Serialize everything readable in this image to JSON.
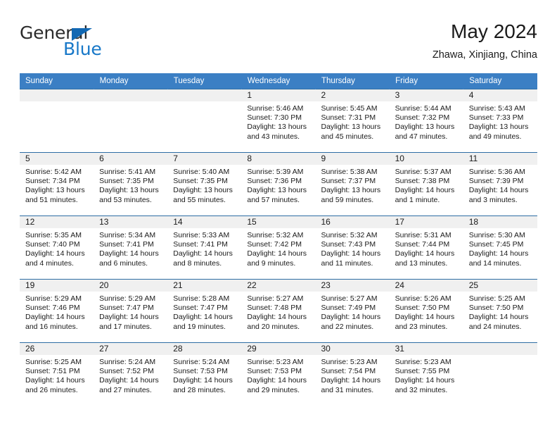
{
  "brand": {
    "name_top": "General",
    "name_bottom": "Blue",
    "triangle_color": "#1268b3",
    "blue_text_color": "#1878c8"
  },
  "header": {
    "title": "May 2024",
    "location": "Zhawa, Xinjiang, China"
  },
  "theme": {
    "header_blue": "#3b7fc4",
    "row_rule_blue": "#2e6da4",
    "daynum_band": "#f0f0f0",
    "text": "#1a1a1a"
  },
  "calendar": {
    "weekday_headers": [
      "Sunday",
      "Monday",
      "Tuesday",
      "Wednesday",
      "Thursday",
      "Friday",
      "Saturday"
    ],
    "weeks": [
      [
        {
          "day": "",
          "sunrise": "",
          "sunset": "",
          "daylight_line1": "",
          "daylight_line2": ""
        },
        {
          "day": "",
          "sunrise": "",
          "sunset": "",
          "daylight_line1": "",
          "daylight_line2": ""
        },
        {
          "day": "",
          "sunrise": "",
          "sunset": "",
          "daylight_line1": "",
          "daylight_line2": ""
        },
        {
          "day": "1",
          "sunrise": "Sunrise: 5:46 AM",
          "sunset": "Sunset: 7:30 PM",
          "daylight_line1": "Daylight: 13 hours",
          "daylight_line2": "and 43 minutes."
        },
        {
          "day": "2",
          "sunrise": "Sunrise: 5:45 AM",
          "sunset": "Sunset: 7:31 PM",
          "daylight_line1": "Daylight: 13 hours",
          "daylight_line2": "and 45 minutes."
        },
        {
          "day": "3",
          "sunrise": "Sunrise: 5:44 AM",
          "sunset": "Sunset: 7:32 PM",
          "daylight_line1": "Daylight: 13 hours",
          "daylight_line2": "and 47 minutes."
        },
        {
          "day": "4",
          "sunrise": "Sunrise: 5:43 AM",
          "sunset": "Sunset: 7:33 PM",
          "daylight_line1": "Daylight: 13 hours",
          "daylight_line2": "and 49 minutes."
        }
      ],
      [
        {
          "day": "5",
          "sunrise": "Sunrise: 5:42 AM",
          "sunset": "Sunset: 7:34 PM",
          "daylight_line1": "Daylight: 13 hours",
          "daylight_line2": "and 51 minutes."
        },
        {
          "day": "6",
          "sunrise": "Sunrise: 5:41 AM",
          "sunset": "Sunset: 7:35 PM",
          "daylight_line1": "Daylight: 13 hours",
          "daylight_line2": "and 53 minutes."
        },
        {
          "day": "7",
          "sunrise": "Sunrise: 5:40 AM",
          "sunset": "Sunset: 7:35 PM",
          "daylight_line1": "Daylight: 13 hours",
          "daylight_line2": "and 55 minutes."
        },
        {
          "day": "8",
          "sunrise": "Sunrise: 5:39 AM",
          "sunset": "Sunset: 7:36 PM",
          "daylight_line1": "Daylight: 13 hours",
          "daylight_line2": "and 57 minutes."
        },
        {
          "day": "9",
          "sunrise": "Sunrise: 5:38 AM",
          "sunset": "Sunset: 7:37 PM",
          "daylight_line1": "Daylight: 13 hours",
          "daylight_line2": "and 59 minutes."
        },
        {
          "day": "10",
          "sunrise": "Sunrise: 5:37 AM",
          "sunset": "Sunset: 7:38 PM",
          "daylight_line1": "Daylight: 14 hours",
          "daylight_line2": "and 1 minute."
        },
        {
          "day": "11",
          "sunrise": "Sunrise: 5:36 AM",
          "sunset": "Sunset: 7:39 PM",
          "daylight_line1": "Daylight: 14 hours",
          "daylight_line2": "and 3 minutes."
        }
      ],
      [
        {
          "day": "12",
          "sunrise": "Sunrise: 5:35 AM",
          "sunset": "Sunset: 7:40 PM",
          "daylight_line1": "Daylight: 14 hours",
          "daylight_line2": "and 4 minutes."
        },
        {
          "day": "13",
          "sunrise": "Sunrise: 5:34 AM",
          "sunset": "Sunset: 7:41 PM",
          "daylight_line1": "Daylight: 14 hours",
          "daylight_line2": "and 6 minutes."
        },
        {
          "day": "14",
          "sunrise": "Sunrise: 5:33 AM",
          "sunset": "Sunset: 7:41 PM",
          "daylight_line1": "Daylight: 14 hours",
          "daylight_line2": "and 8 minutes."
        },
        {
          "day": "15",
          "sunrise": "Sunrise: 5:32 AM",
          "sunset": "Sunset: 7:42 PM",
          "daylight_line1": "Daylight: 14 hours",
          "daylight_line2": "and 9 minutes."
        },
        {
          "day": "16",
          "sunrise": "Sunrise: 5:32 AM",
          "sunset": "Sunset: 7:43 PM",
          "daylight_line1": "Daylight: 14 hours",
          "daylight_line2": "and 11 minutes."
        },
        {
          "day": "17",
          "sunrise": "Sunrise: 5:31 AM",
          "sunset": "Sunset: 7:44 PM",
          "daylight_line1": "Daylight: 14 hours",
          "daylight_line2": "and 13 minutes."
        },
        {
          "day": "18",
          "sunrise": "Sunrise: 5:30 AM",
          "sunset": "Sunset: 7:45 PM",
          "daylight_line1": "Daylight: 14 hours",
          "daylight_line2": "and 14 minutes."
        }
      ],
      [
        {
          "day": "19",
          "sunrise": "Sunrise: 5:29 AM",
          "sunset": "Sunset: 7:46 PM",
          "daylight_line1": "Daylight: 14 hours",
          "daylight_line2": "and 16 minutes."
        },
        {
          "day": "20",
          "sunrise": "Sunrise: 5:29 AM",
          "sunset": "Sunset: 7:47 PM",
          "daylight_line1": "Daylight: 14 hours",
          "daylight_line2": "and 17 minutes."
        },
        {
          "day": "21",
          "sunrise": "Sunrise: 5:28 AM",
          "sunset": "Sunset: 7:47 PM",
          "daylight_line1": "Daylight: 14 hours",
          "daylight_line2": "and 19 minutes."
        },
        {
          "day": "22",
          "sunrise": "Sunrise: 5:27 AM",
          "sunset": "Sunset: 7:48 PM",
          "daylight_line1": "Daylight: 14 hours",
          "daylight_line2": "and 20 minutes."
        },
        {
          "day": "23",
          "sunrise": "Sunrise: 5:27 AM",
          "sunset": "Sunset: 7:49 PM",
          "daylight_line1": "Daylight: 14 hours",
          "daylight_line2": "and 22 minutes."
        },
        {
          "day": "24",
          "sunrise": "Sunrise: 5:26 AM",
          "sunset": "Sunset: 7:50 PM",
          "daylight_line1": "Daylight: 14 hours",
          "daylight_line2": "and 23 minutes."
        },
        {
          "day": "25",
          "sunrise": "Sunrise: 5:25 AM",
          "sunset": "Sunset: 7:50 PM",
          "daylight_line1": "Daylight: 14 hours",
          "daylight_line2": "and 24 minutes."
        }
      ],
      [
        {
          "day": "26",
          "sunrise": "Sunrise: 5:25 AM",
          "sunset": "Sunset: 7:51 PM",
          "daylight_line1": "Daylight: 14 hours",
          "daylight_line2": "and 26 minutes."
        },
        {
          "day": "27",
          "sunrise": "Sunrise: 5:24 AM",
          "sunset": "Sunset: 7:52 PM",
          "daylight_line1": "Daylight: 14 hours",
          "daylight_line2": "and 27 minutes."
        },
        {
          "day": "28",
          "sunrise": "Sunrise: 5:24 AM",
          "sunset": "Sunset: 7:53 PM",
          "daylight_line1": "Daylight: 14 hours",
          "daylight_line2": "and 28 minutes."
        },
        {
          "day": "29",
          "sunrise": "Sunrise: 5:23 AM",
          "sunset": "Sunset: 7:53 PM",
          "daylight_line1": "Daylight: 14 hours",
          "daylight_line2": "and 29 minutes."
        },
        {
          "day": "30",
          "sunrise": "Sunrise: 5:23 AM",
          "sunset": "Sunset: 7:54 PM",
          "daylight_line1": "Daylight: 14 hours",
          "daylight_line2": "and 31 minutes."
        },
        {
          "day": "31",
          "sunrise": "Sunrise: 5:23 AM",
          "sunset": "Sunset: 7:55 PM",
          "daylight_line1": "Daylight: 14 hours",
          "daylight_line2": "and 32 minutes."
        },
        {
          "day": "",
          "sunrise": "",
          "sunset": "",
          "daylight_line1": "",
          "daylight_line2": ""
        }
      ]
    ]
  }
}
